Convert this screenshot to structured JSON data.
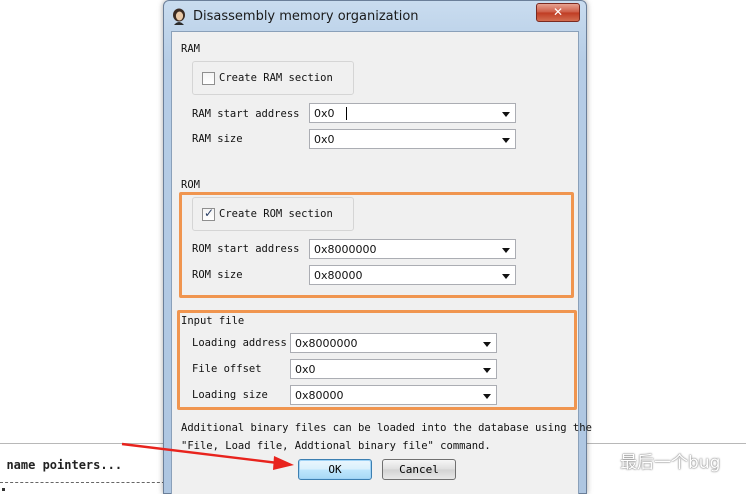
{
  "window": {
    "title": "Disassembly memory organization",
    "close_glyph": "✕"
  },
  "ram": {
    "section_label": "RAM",
    "create_label": "Create RAM section",
    "create_checked": false,
    "start_label": "RAM start address",
    "start_value": "0x0",
    "size_label": "RAM size",
    "size_value": "0x0"
  },
  "rom": {
    "section_label": "ROM",
    "create_label": "Create ROM section",
    "create_checked": true,
    "start_label": "ROM start address",
    "start_value": "0x8000000",
    "size_label": "ROM size",
    "size_value": "0x80000"
  },
  "input_file": {
    "section_label": "Input file",
    "loading_address_label": "Loading address",
    "loading_address_value": "0x8000000",
    "file_offset_label": "File offset",
    "file_offset_value": "0x0",
    "loading_size_label": "Loading size",
    "loading_size_value": "0x80000"
  },
  "info_text_line1": "Additional binary files can be loaded into the database using the",
  "info_text_line2": "\"File, Load file, Addtional binary file\" command.",
  "buttons": {
    "ok": "OK",
    "cancel": "Cancel"
  },
  "background": {
    "code_text": "r name pointers..."
  },
  "watermark": {
    "text": "最后一个bug"
  },
  "colors": {
    "highlight": "#f0954f",
    "annotation_arrow": "#e8231d",
    "default_button_border": "#3c7fb1"
  }
}
